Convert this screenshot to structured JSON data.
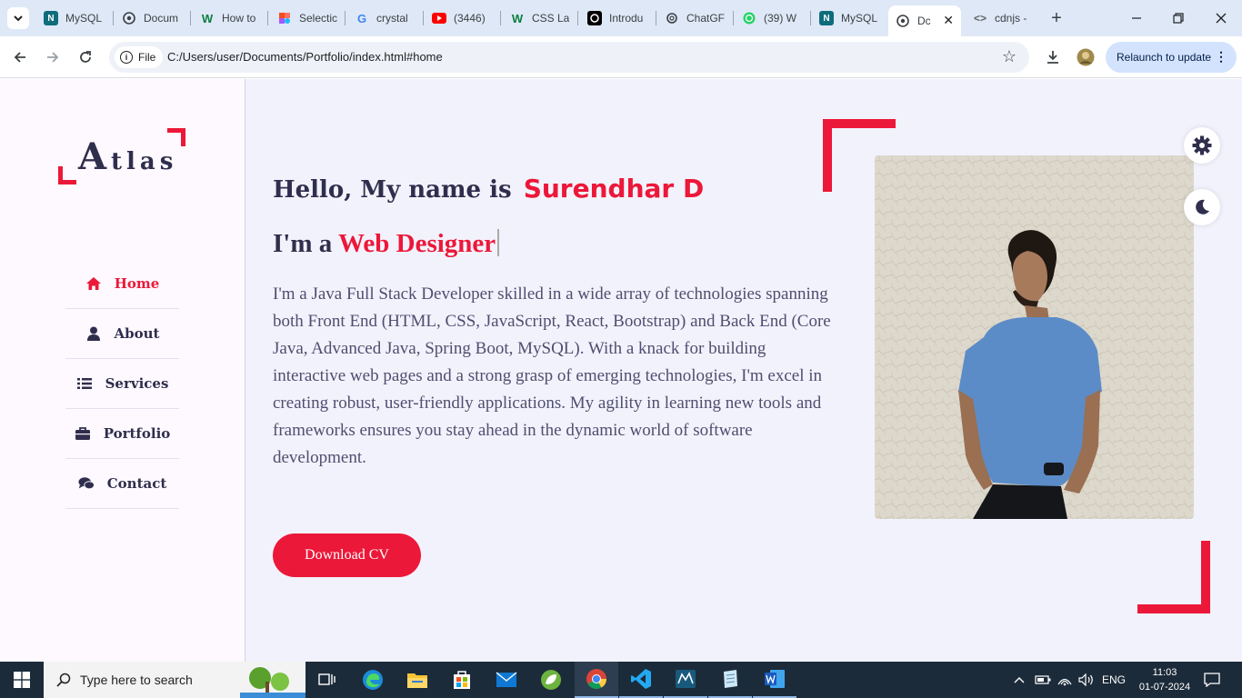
{
  "browser": {
    "tabs": [
      {
        "label": "MySQL",
        "icon": "mysql-icon"
      },
      {
        "label": "Docum",
        "icon": "globe-icon"
      },
      {
        "label": "How to",
        "icon": "w-icon"
      },
      {
        "label": "Selectic",
        "icon": "figma-icon"
      },
      {
        "label": "crystal",
        "icon": "google-icon"
      },
      {
        "label": "(3446)",
        "icon": "youtube-icon"
      },
      {
        "label": "CSS La",
        "icon": "w-icon"
      },
      {
        "label": "Introdu",
        "icon": "openai-icon"
      },
      {
        "label": "ChatGF",
        "icon": "openai-icon"
      },
      {
        "label": "(39) W",
        "icon": "whatsapp-icon"
      },
      {
        "label": "MySQL",
        "icon": "mysql-icon"
      },
      {
        "label": "Dc",
        "icon": "globe-icon",
        "active": true
      },
      {
        "label": "cdnjs -",
        "icon": "code-icon"
      }
    ],
    "new_tab": "+",
    "address": {
      "chip_label": "File",
      "url": "C:/Users/user/Documents/Portfolio/index.html#home"
    },
    "relaunch_label": "Relaunch to update"
  },
  "site": {
    "logo": {
      "first": "A",
      "rest": "tlas"
    },
    "nav": [
      {
        "label": "Home",
        "icon": "home-icon",
        "active": true
      },
      {
        "label": "About",
        "icon": "user-icon"
      },
      {
        "label": "Services",
        "icon": "list-icon"
      },
      {
        "label": "Portfolio",
        "icon": "briefcase-icon"
      },
      {
        "label": "Contact",
        "icon": "comments-icon"
      }
    ],
    "hero": {
      "greeting": "Hello, My name is",
      "name": "Surendhar D",
      "role_prefix": "I'm a",
      "role": "Web Designer",
      "bio": "I'm a Java Full Stack Developer skilled in a wide array of technologies spanning both Front End (HTML, CSS, JavaScript, React, Bootstrap) and Back End (Core Java, Advanced Java, Spring Boot, MySQL). With a knack for building interactive web pages and a strong grasp of emerging technologies, I'm excel in creating robust, user-friendly applications. My agility in learning new tools and frameworks ensures you stay ahead in the dynamic world of software development.",
      "cv_button": "Download CV"
    },
    "colors": {
      "accent": "#ec1839",
      "text": "#302e4d",
      "body_text": "#504e70",
      "bg": "#f2f2fc"
    }
  },
  "taskbar": {
    "search_placeholder": "Type here to search",
    "language": "ENG",
    "time": "11:03",
    "date": "01-07-2024"
  }
}
